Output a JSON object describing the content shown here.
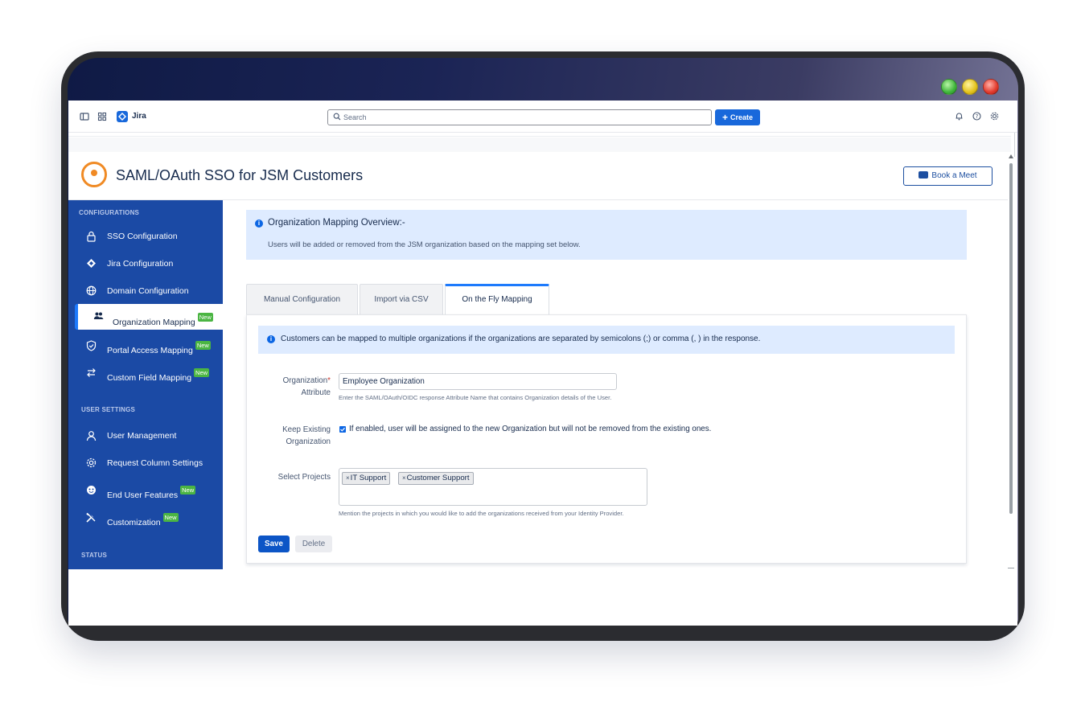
{
  "topbar": {
    "app_name": "Jira",
    "search_placeholder": "Search",
    "create_label": "Create"
  },
  "header": {
    "title": "SAML/OAuth SSO for JSM Customers",
    "book_meet_label": "Book a Meet"
  },
  "sidebar": {
    "sections": {
      "configurations": "CONFIGURATIONS",
      "user_settings": "USER SETTINGS",
      "status": "STATUS"
    },
    "badge_new": "New",
    "items": [
      {
        "label": "SSO Configuration",
        "icon": "lock-icon",
        "new": false
      },
      {
        "label": "Jira Configuration",
        "icon": "jira-icon",
        "new": false
      },
      {
        "label": "Domain Configuration",
        "icon": "globe-icon",
        "new": false
      },
      {
        "label": "Organization Mapping",
        "icon": "users-icon",
        "new": true,
        "active": true
      },
      {
        "label": "Portal Access Mapping",
        "icon": "shield-check-icon",
        "new": true
      },
      {
        "label": "Custom Field Mapping",
        "icon": "swap-icon",
        "new": true
      },
      {
        "label": "User Management",
        "icon": "user-icon",
        "new": false
      },
      {
        "label": "Request Column Settings",
        "icon": "gear-icon",
        "new": false
      },
      {
        "label": "End User Features",
        "icon": "face-icon",
        "new": true
      },
      {
        "label": "Customization",
        "icon": "tools-icon",
        "new": true
      }
    ]
  },
  "overview": {
    "title": "Organization Mapping Overview:-",
    "text": "Users will be added or removed from the JSM organization based on the mapping set below."
  },
  "tabs": [
    {
      "label": "Manual Configuration",
      "active": false
    },
    {
      "label": "Import via CSV",
      "active": false
    },
    {
      "label": "On the Fly Mapping",
      "active": true
    }
  ],
  "panel": {
    "note": "Customers can be mapped to multiple organizations if the organizations are separated by semicolons (;) or comma (, ) in the response.",
    "org_attribute": {
      "label_line1": "Organization",
      "required_mark": "*",
      "label_line2": "Attribute",
      "value": "Employee Organization",
      "help": "Enter the SAML/OAuth/OIDC response Attribute Name that contains Organization details of the User."
    },
    "keep_existing": {
      "label_line1": "Keep Existing",
      "label_line2": "Organization",
      "checked": true,
      "text": "If enabled, user will be assigned to the new Organization but will not be removed from the existing ones."
    },
    "select_projects": {
      "label": "Select Projects",
      "chips": [
        "IT Support",
        "Customer Support"
      ],
      "chip_remove": "×",
      "help": "Mention the projects in which you would like to add the organizations received from your Identity Provider."
    },
    "save_label": "Save",
    "delete_label": "Delete"
  },
  "colors": {
    "sidebar_bg": "#1b4aa5",
    "primary": "#0c55c6",
    "info_bg": "#deebff",
    "new_badge": "#4bb543",
    "logo_orange": "#f08a24"
  }
}
